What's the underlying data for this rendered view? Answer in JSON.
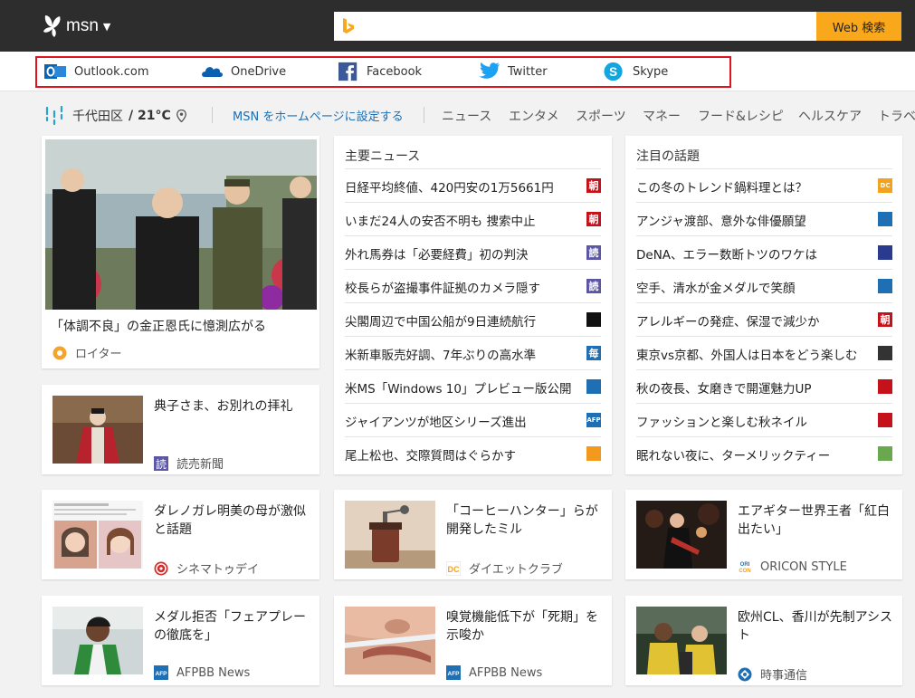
{
  "header": {
    "logo_text": "msn",
    "search_placeholder": "",
    "search_button": "Web 検索",
    "brand_color": "#f9a81b"
  },
  "quick_links": [
    {
      "label": "Outlook.com",
      "icon": "outlook-icon"
    },
    {
      "label": "OneDrive",
      "icon": "onedrive-icon"
    },
    {
      "label": "Facebook",
      "icon": "facebook-icon"
    },
    {
      "label": "Twitter",
      "icon": "twitter-icon"
    },
    {
      "label": "Skype",
      "icon": "skype-icon"
    }
  ],
  "weather": {
    "location": "千代田区",
    "temp": "/ 21°C"
  },
  "nav": {
    "homepage": "MSN をホームページに設定する",
    "items": [
      "ニュース",
      "エンタメ",
      "スポーツ",
      "マネー",
      "フード&レシピ",
      "ヘルスケア",
      "トラベ"
    ]
  },
  "hero": {
    "title": "「体調不良」の金正恩氏に憶測広がる",
    "source": "ロイター"
  },
  "top_news": {
    "heading": "主要ニュース",
    "items": [
      {
        "text": "日経平均終値、420円安の1万5661円",
        "badge": "朝",
        "badge_color": "#c5121a"
      },
      {
        "text": "いまだ24人の安否不明も 捜索中止",
        "badge": "朝",
        "badge_color": "#c5121a"
      },
      {
        "text": "外れ馬券は「必要経費」初の判決",
        "badge": "読",
        "badge_color": "#5b56a6"
      },
      {
        "text": "校長らが盗撮事件証拠のカメラ隠す",
        "badge": "読",
        "badge_color": "#5b56a6"
      },
      {
        "text": "尖閣周辺で中国公船が9日連続航行",
        "badge": "",
        "badge_color": "#111111"
      },
      {
        "text": "米新車販売好調、7年ぶりの高水準",
        "badge": "毎",
        "badge_color": "#1f6fb5"
      },
      {
        "text": "米MS「Windows 10」プレビュー版公開",
        "badge": "",
        "badge_color": "#1f6fb5"
      },
      {
        "text": "ジャイアンツが地区シリーズ進出",
        "badge": "AFP",
        "badge_color": "#1f6fb5"
      },
      {
        "text": "尾上松也、交際質問はぐらかす",
        "badge": "",
        "badge_color": "#f39a1e"
      }
    ]
  },
  "trending": {
    "heading": "注目の話題",
    "items": [
      {
        "text": "この冬のトレンド鍋料理とは？",
        "badge": "DC",
        "badge_color": "#f3a21e"
      },
      {
        "text": "アンジャ渡部、意外な俳優願望",
        "badge": "",
        "badge_color": "#1f6fb5"
      },
      {
        "text": "DeNA、エラー数断トツのワケは",
        "badge": "",
        "badge_color": "#2a3b8f"
      },
      {
        "text": "空手、清水が金メダルで笑顔",
        "badge": "",
        "badge_color": "#1f6fb5"
      },
      {
        "text": "アレルギーの発症、保湿で減少か",
        "badge": "朝",
        "badge_color": "#c5121a"
      },
      {
        "text": "東京vs京都、外国人は日本をどう楽しむ",
        "badge": "",
        "badge_color": "#333333"
      },
      {
        "text": "秋の夜長、女磨きで開運魅力UP",
        "badge": "",
        "badge_color": "#c5121a"
      },
      {
        "text": "ファッションと楽しむ秋ネイル",
        "badge": "",
        "badge_color": "#c5121a"
      },
      {
        "text": "眠れない夜に、ターメリックティー",
        "badge": "",
        "badge_color": "#6aa84f"
      }
    ]
  },
  "stories": [
    {
      "title": "典子さま、お別れの拝礼",
      "source": "読売新聞",
      "src_icon": "yomiuri-icon"
    },
    {
      "title": "ダレノガレ明美の母が激似と話題",
      "source": "シネマトゥデイ",
      "src_icon": "cinematoday-icon"
    },
    {
      "title": "「コーヒーハンター」らが開発したミル",
      "source": "ダイエットクラブ",
      "src_icon": "dietclub-icon"
    },
    {
      "title": "エアギター世界王者「紅白出たい」",
      "source": "ORICON STYLE",
      "src_icon": "oricon-icon"
    },
    {
      "title": "メダル拒否「フェアプレーの徹底を」",
      "source": "AFPBB News",
      "src_icon": "afp-icon"
    },
    {
      "title": "嗅覚機能低下が「死期」を示唆か",
      "source": "AFPBB News",
      "src_icon": "afp-icon"
    },
    {
      "title": "欧州CL、香川が先制アシスト",
      "source": "時事通信",
      "src_icon": "jiji-icon"
    }
  ]
}
